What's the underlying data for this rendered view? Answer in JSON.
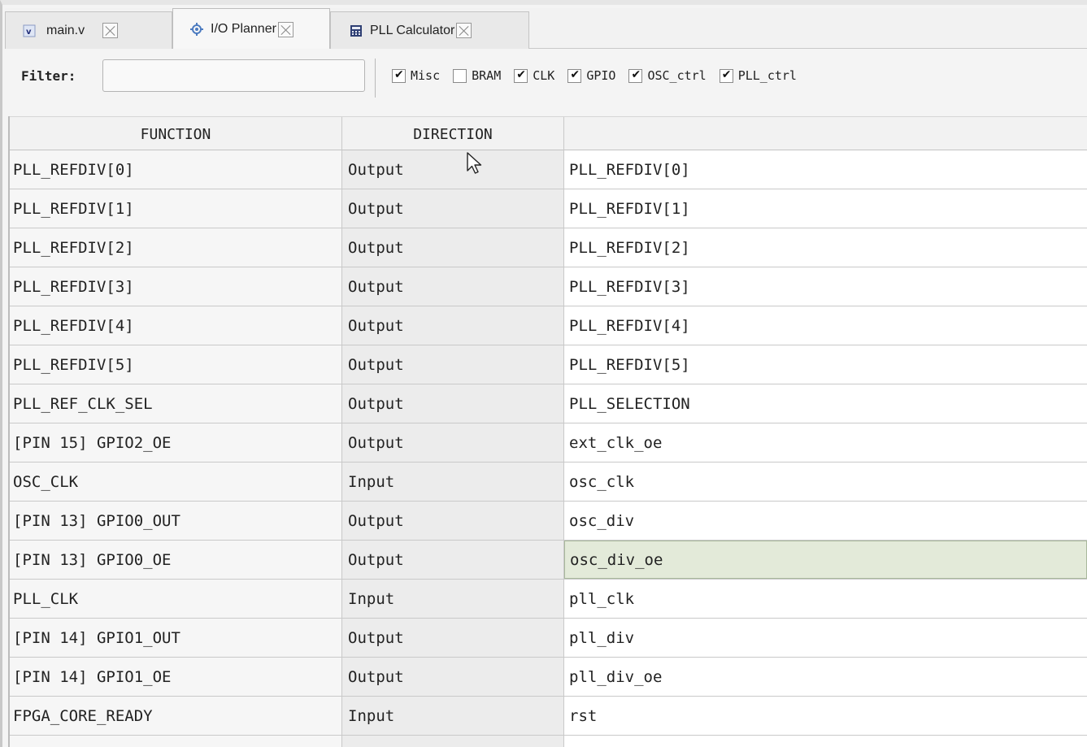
{
  "tabs": [
    {
      "label": "main.v",
      "icon": "verilog-file-icon"
    },
    {
      "label": "I/O Planner",
      "icon": "io-planner-icon"
    },
    {
      "label": "PLL Calculator",
      "icon": "calculator-icon"
    }
  ],
  "filter": {
    "label": "Filter:",
    "value": "",
    "checkboxes": [
      {
        "label": "Misc",
        "checked": true
      },
      {
        "label": "BRAM",
        "checked": false
      },
      {
        "label": "CLK",
        "checked": true
      },
      {
        "label": "GPIO",
        "checked": true
      },
      {
        "label": "OSC_ctrl",
        "checked": true
      },
      {
        "label": "PLL_ctrl",
        "checked": true
      }
    ]
  },
  "table": {
    "columns": [
      "FUNCTION",
      "DIRECTION",
      ""
    ],
    "rows": [
      [
        "PLL_REFDIV[0]",
        "Output",
        "PLL_REFDIV[0]"
      ],
      [
        "PLL_REFDIV[1]",
        "Output",
        "PLL_REFDIV[1]"
      ],
      [
        "PLL_REFDIV[2]",
        "Output",
        "PLL_REFDIV[2]"
      ],
      [
        "PLL_REFDIV[3]",
        "Output",
        "PLL_REFDIV[3]"
      ],
      [
        "PLL_REFDIV[4]",
        "Output",
        "PLL_REFDIV[4]"
      ],
      [
        "PLL_REFDIV[5]",
        "Output",
        "PLL_REFDIV[5]"
      ],
      [
        "PLL_REF_CLK_SEL",
        "Output",
        "PLL_SELECTION"
      ],
      [
        "[PIN 15] GPIO2_OE",
        "Output",
        "ext_clk_oe"
      ],
      [
        "OSC_CLK",
        "Input",
        "osc_clk"
      ],
      [
        "[PIN 13] GPIO0_OUT",
        "Output",
        "osc_div"
      ],
      [
        "[PIN 13] GPIO0_OE",
        "Output",
        "osc_div_oe"
      ],
      [
        "PLL_CLK",
        "Input",
        "pll_clk"
      ],
      [
        "[PIN 14] GPIO1_OUT",
        "Output",
        "pll_div"
      ],
      [
        "[PIN 14] GPIO1_OE",
        "Output",
        "pll_div_oe"
      ],
      [
        "FPGA_CORE_READY",
        "Input",
        "rst"
      ],
      [
        "",
        "",
        ""
      ]
    ],
    "selected_row": 10
  }
}
